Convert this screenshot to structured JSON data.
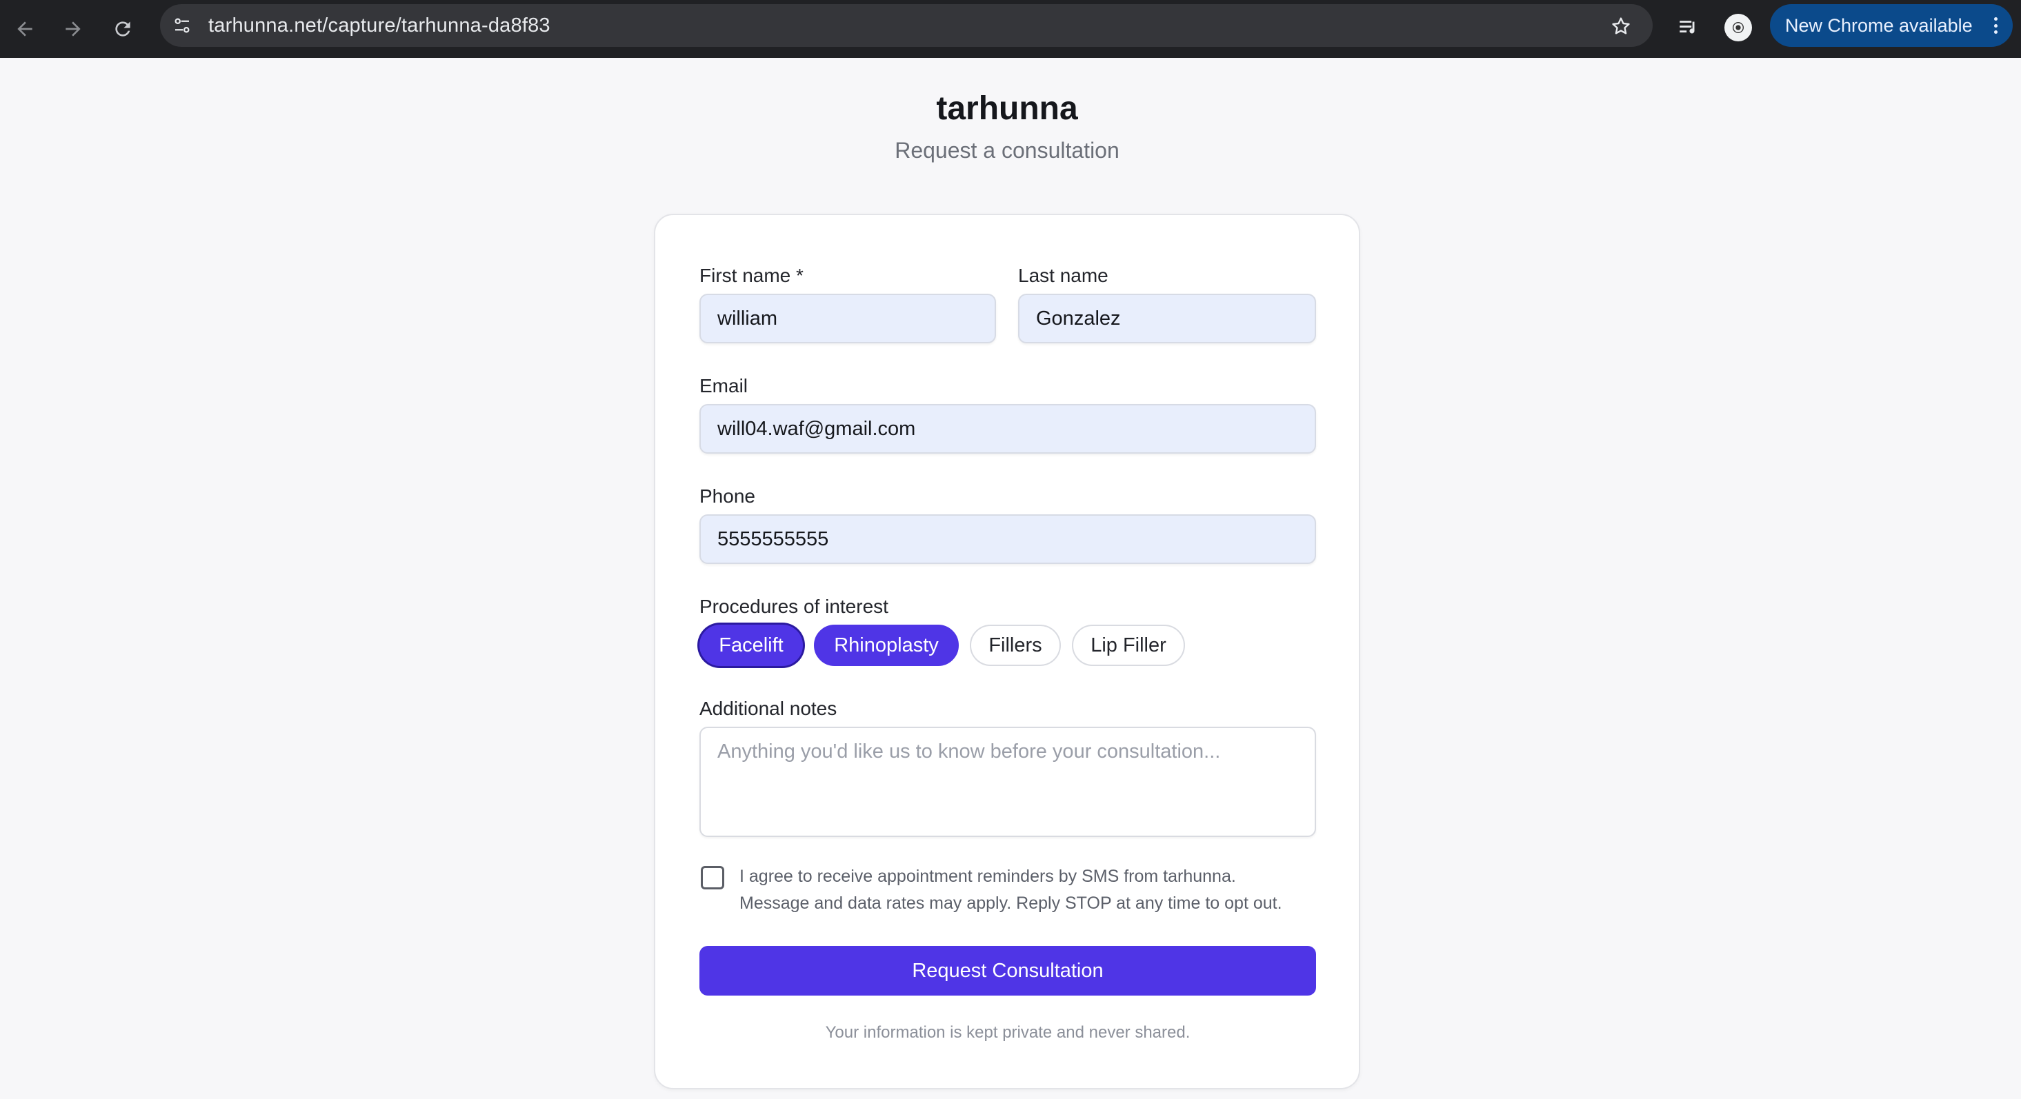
{
  "browser": {
    "url": "tarhunna.net/capture/tarhunna-da8f83",
    "update_label": "New Chrome available",
    "icons": {
      "back": "arrow-left-icon",
      "forward": "arrow-right-icon",
      "reload": "reload-icon",
      "site_info": "tune-icon",
      "bookmark": "star-icon",
      "media": "media-queue-icon",
      "profile": "profile-avatar-icon",
      "menu": "kebab-menu-icon"
    }
  },
  "page": {
    "brand": "tarhunna",
    "tagline": "Request a consultation"
  },
  "form": {
    "first_name": {
      "label": "First name *",
      "value": "william"
    },
    "last_name": {
      "label": "Last name",
      "value": "Gonzalez"
    },
    "email": {
      "label": "Email",
      "value": "will04.waf@gmail.com"
    },
    "phone": {
      "label": "Phone",
      "value": "5555555555"
    },
    "procedures": {
      "label": "Procedures of interest",
      "options": [
        {
          "label": "Facelift",
          "selected": true
        },
        {
          "label": "Rhinoplasty",
          "selected": true
        },
        {
          "label": "Fillers",
          "selected": false
        },
        {
          "label": "Lip Filler",
          "selected": false
        }
      ]
    },
    "notes": {
      "label": "Additional notes",
      "placeholder": "Anything you'd like us to know before your consultation..."
    },
    "consent": {
      "checked": false,
      "line1": "I agree to receive appointment reminders by SMS from tarhunna.",
      "line2": "Message and data rates may apply. Reply STOP at any time to opt out."
    },
    "submit_label": "Request Consultation",
    "privacy_note": "Your information is kept private and never shared."
  },
  "colors": {
    "accent": "#4f35e6",
    "input_fill": "#e8eefc",
    "chrome_bg": "#202124",
    "update_pill": "#0b4a8b"
  }
}
